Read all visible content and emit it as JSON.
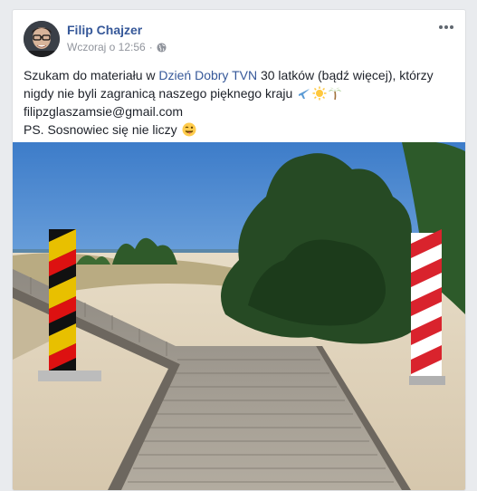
{
  "post": {
    "author": "Filip Chajzer",
    "timestamp": "Wczoraj o 12:56",
    "privacy_icon": "globe-icon",
    "more_icon": "ellipsis-icon",
    "text_part1": "Szukam do materiału w ",
    "link_text": "Dzień Dobry TVN",
    "text_part2": " 30 latków (bądź więcej), którzy nigdy nie byli zagranicą naszego pięknego kraju ",
    "emojis_line1": [
      "airplane-emoji",
      "sun-emoji",
      "palm-tree-emoji"
    ],
    "email": "filipzglaszamsie@gmail.com",
    "ps_text": "PS. Sosnowiec się nie liczy ",
    "ps_emoji": "tongue-wink-emoji",
    "image_description_icon": "border-posts-photo"
  },
  "colors": {
    "author_link": "#365899",
    "meta_gray": "#90949c",
    "background": "#e9ebee"
  }
}
